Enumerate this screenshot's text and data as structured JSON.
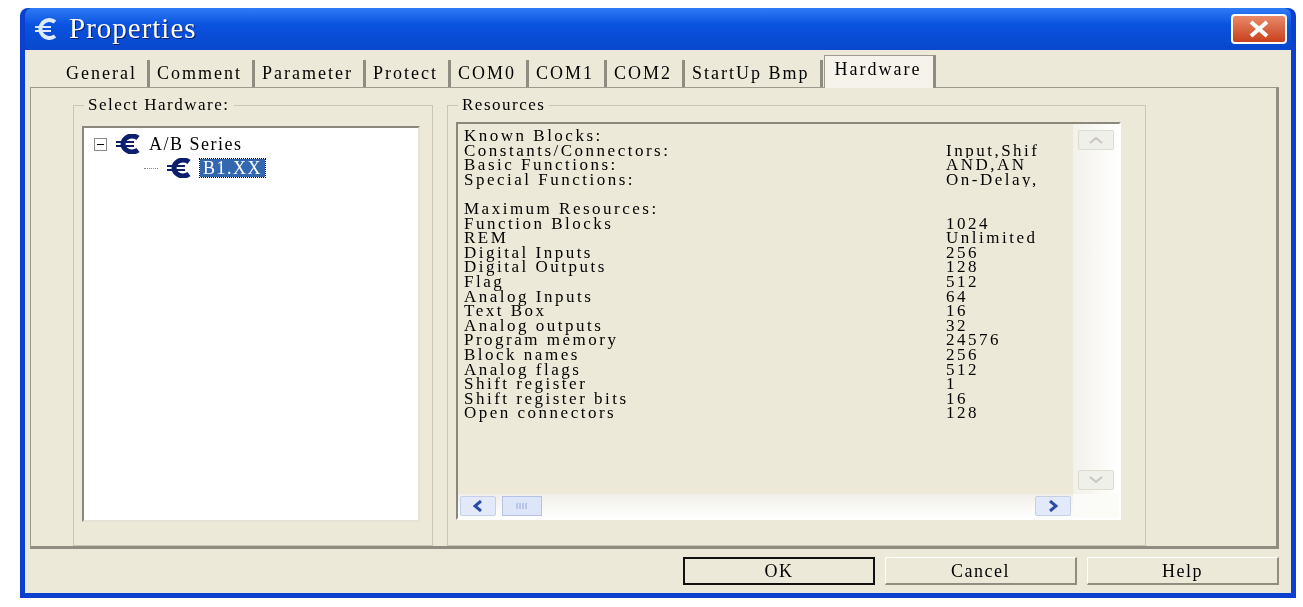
{
  "window": {
    "title": "Properties"
  },
  "tabs": [
    {
      "label": "General",
      "selected": false
    },
    {
      "label": "Comment",
      "selected": false
    },
    {
      "label": "Parameter",
      "selected": false
    },
    {
      "label": "Protect",
      "selected": false
    },
    {
      "label": "COM0",
      "selected": false
    },
    {
      "label": "COM1",
      "selected": false
    },
    {
      "label": "COM2",
      "selected": false
    },
    {
      "label": "StartUp Bmp",
      "selected": false
    },
    {
      "label": "Hardware",
      "selected": true
    }
  ],
  "select_hardware": {
    "legend": "Select Hardware:",
    "tree": [
      {
        "label": "A/B Series",
        "expanded": true,
        "selected": false,
        "children": [
          {
            "label": "B1.XX",
            "selected": true
          }
        ]
      }
    ]
  },
  "resources": {
    "legend": "Resources",
    "sections": [
      {
        "heading": "Known Blocks:",
        "rows": [
          {
            "label": "Constants/Connectors:",
            "value": "Input,Shif"
          },
          {
            "label": "Basic Functions:",
            "value": "AND,AN"
          },
          {
            "label": "Special Functions:",
            "value": "On-Delay,"
          }
        ]
      },
      {
        "heading": "Maximum Resources:",
        "rows": [
          {
            "label": "Function Blocks",
            "value": "1024"
          },
          {
            "label": "REM",
            "value": "Unlimited"
          },
          {
            "label": "Digital Inputs",
            "value": "256"
          },
          {
            "label": "Digital Outputs",
            "value": "128"
          },
          {
            "label": "Flag",
            "value": "512"
          },
          {
            "label": "Analog Inputs",
            "value": "64"
          },
          {
            "label": "Text Box",
            "value": "16"
          },
          {
            "label": "Analog outputs",
            "value": "32"
          },
          {
            "label": "Program memory",
            "value": "24576"
          },
          {
            "label": "Block names",
            "value": "256"
          },
          {
            "label": "Analog flags",
            "value": "512"
          },
          {
            "label": "Shift register",
            "value": "1"
          },
          {
            "label": "Shift register bits",
            "value": "16"
          },
          {
            "label": "Open connectors",
            "value": "128"
          }
        ]
      }
    ]
  },
  "buttons": [
    {
      "label": "OK",
      "focused": true
    },
    {
      "label": "Cancel",
      "focused": false
    },
    {
      "label": "Help",
      "focused": false
    }
  ]
}
